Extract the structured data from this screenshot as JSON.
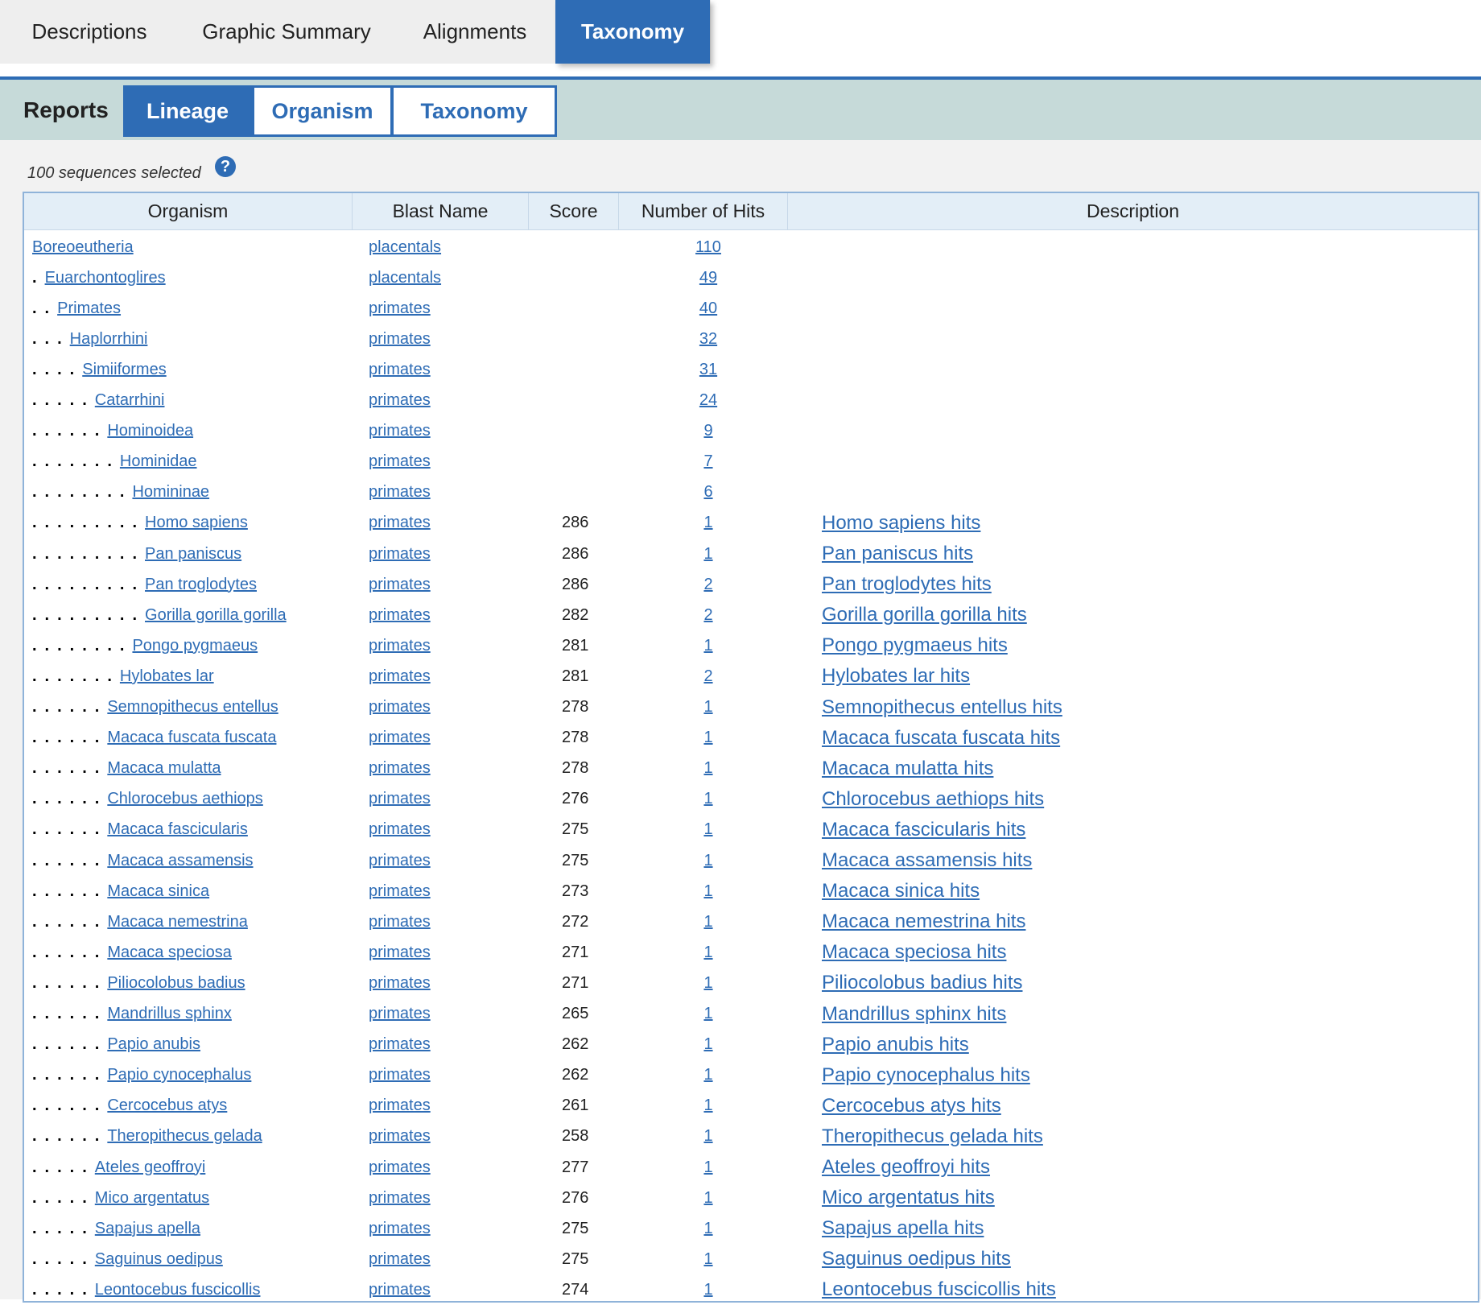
{
  "top_tabs": [
    {
      "label": "Descriptions",
      "active": false
    },
    {
      "label": "Graphic Summary",
      "active": false
    },
    {
      "label": "Alignments",
      "active": false
    },
    {
      "label": "Taxonomy",
      "active": true
    }
  ],
  "reports": {
    "label": "Reports",
    "tabs": [
      {
        "label": "Lineage",
        "active": true
      },
      {
        "label": "Organism",
        "active": false
      },
      {
        "label": "Taxonomy",
        "active": false
      }
    ]
  },
  "selection": {
    "text": "100 sequences selected",
    "help_icon": "?"
  },
  "colors": {
    "accent": "#2e6cb5",
    "reports_bar": "#c6dad9",
    "header_bg": "#e3eef7"
  },
  "table": {
    "columns": [
      "Organism",
      "Blast Name",
      "Score",
      "Number of Hits",
      "Description"
    ],
    "rows": [
      {
        "depth": 0,
        "organism": "Boreoeutheria",
        "blast_name": "placentals",
        "score": "",
        "hits": "110",
        "description": ""
      },
      {
        "depth": 1,
        "organism": "Euarchontoglires",
        "blast_name": "placentals",
        "score": "",
        "hits": "49",
        "description": ""
      },
      {
        "depth": 2,
        "organism": "Primates",
        "blast_name": "primates",
        "score": "",
        "hits": "40",
        "description": ""
      },
      {
        "depth": 3,
        "organism": "Haplorrhini",
        "blast_name": "primates",
        "score": "",
        "hits": "32",
        "description": ""
      },
      {
        "depth": 4,
        "organism": "Simiiformes",
        "blast_name": "primates",
        "score": "",
        "hits": "31",
        "description": ""
      },
      {
        "depth": 5,
        "organism": "Catarrhini",
        "blast_name": "primates",
        "score": "",
        "hits": "24",
        "description": ""
      },
      {
        "depth": 6,
        "organism": "Hominoidea",
        "blast_name": "primates",
        "score": "",
        "hits": "9",
        "description": ""
      },
      {
        "depth": 7,
        "organism": "Hominidae",
        "blast_name": "primates",
        "score": "",
        "hits": "7",
        "description": ""
      },
      {
        "depth": 8,
        "organism": "Homininae",
        "blast_name": "primates",
        "score": "",
        "hits": "6",
        "description": ""
      },
      {
        "depth": 9,
        "organism": "Homo sapiens",
        "blast_name": "primates",
        "score": "286",
        "hits": "1",
        "description": "Homo sapiens hits"
      },
      {
        "depth": 9,
        "organism": "Pan paniscus",
        "blast_name": "primates",
        "score": "286",
        "hits": "1",
        "description": "Pan paniscus hits"
      },
      {
        "depth": 9,
        "organism": "Pan troglodytes",
        "blast_name": "primates",
        "score": "286",
        "hits": "2",
        "description": "Pan troglodytes hits"
      },
      {
        "depth": 9,
        "organism": "Gorilla gorilla gorilla",
        "blast_name": "primates",
        "score": "282",
        "hits": "2",
        "description": "Gorilla gorilla gorilla hits"
      },
      {
        "depth": 8,
        "organism": "Pongo pygmaeus",
        "blast_name": "primates",
        "score": "281",
        "hits": "1",
        "description": "Pongo pygmaeus hits"
      },
      {
        "depth": 7,
        "organism": "Hylobates lar",
        "blast_name": "primates",
        "score": "281",
        "hits": "2",
        "description": "Hylobates lar hits"
      },
      {
        "depth": 6,
        "organism": "Semnopithecus entellus",
        "blast_name": "primates",
        "score": "278",
        "hits": "1",
        "description": "Semnopithecus entellus hits"
      },
      {
        "depth": 6,
        "organism": "Macaca fuscata fuscata",
        "blast_name": "primates",
        "score": "278",
        "hits": "1",
        "description": "Macaca fuscata fuscata hits"
      },
      {
        "depth": 6,
        "organism": "Macaca mulatta",
        "blast_name": "primates",
        "score": "278",
        "hits": "1",
        "description": "Macaca mulatta hits"
      },
      {
        "depth": 6,
        "organism": "Chlorocebus aethiops",
        "blast_name": "primates",
        "score": "276",
        "hits": "1",
        "description": "Chlorocebus aethiops hits"
      },
      {
        "depth": 6,
        "organism": "Macaca fascicularis",
        "blast_name": "primates",
        "score": "275",
        "hits": "1",
        "description": "Macaca fascicularis hits"
      },
      {
        "depth": 6,
        "organism": "Macaca assamensis",
        "blast_name": "primates",
        "score": "275",
        "hits": "1",
        "description": "Macaca assamensis hits"
      },
      {
        "depth": 6,
        "organism": "Macaca sinica",
        "blast_name": "primates",
        "score": "273",
        "hits": "1",
        "description": "Macaca sinica hits"
      },
      {
        "depth": 6,
        "organism": "Macaca nemestrina",
        "blast_name": "primates",
        "score": "272",
        "hits": "1",
        "description": "Macaca nemestrina hits"
      },
      {
        "depth": 6,
        "organism": "Macaca speciosa",
        "blast_name": "primates",
        "score": "271",
        "hits": "1",
        "description": "Macaca speciosa hits"
      },
      {
        "depth": 6,
        "organism": "Piliocolobus badius",
        "blast_name": "primates",
        "score": "271",
        "hits": "1",
        "description": "Piliocolobus badius hits"
      },
      {
        "depth": 6,
        "organism": "Mandrillus sphinx",
        "blast_name": "primates",
        "score": "265",
        "hits": "1",
        "description": "Mandrillus sphinx hits"
      },
      {
        "depth": 6,
        "organism": "Papio anubis",
        "blast_name": "primates",
        "score": "262",
        "hits": "1",
        "description": "Papio anubis hits"
      },
      {
        "depth": 6,
        "organism": "Papio cynocephalus",
        "blast_name": "primates",
        "score": "262",
        "hits": "1",
        "description": "Papio cynocephalus hits"
      },
      {
        "depth": 6,
        "organism": "Cercocebus atys",
        "blast_name": "primates",
        "score": "261",
        "hits": "1",
        "description": "Cercocebus atys hits"
      },
      {
        "depth": 6,
        "organism": "Theropithecus gelada",
        "blast_name": "primates",
        "score": "258",
        "hits": "1",
        "description": "Theropithecus gelada hits"
      },
      {
        "depth": 5,
        "organism": "Ateles geoffroyi",
        "blast_name": "primates",
        "score": "277",
        "hits": "1",
        "description": "Ateles geoffroyi hits"
      },
      {
        "depth": 5,
        "organism": "Mico argentatus",
        "blast_name": "primates",
        "score": "276",
        "hits": "1",
        "description": "Mico argentatus hits"
      },
      {
        "depth": 5,
        "organism": "Sapajus apella",
        "blast_name": "primates",
        "score": "275",
        "hits": "1",
        "description": "Sapajus apella hits"
      },
      {
        "depth": 5,
        "organism": "Saguinus oedipus",
        "blast_name": "primates",
        "score": "275",
        "hits": "1",
        "description": "Saguinus oedipus hits"
      },
      {
        "depth": 5,
        "organism": "Leontocebus fuscicollis",
        "blast_name": "primates",
        "score": "274",
        "hits": "1",
        "description": "Leontocebus fuscicollis hits"
      }
    ]
  }
}
